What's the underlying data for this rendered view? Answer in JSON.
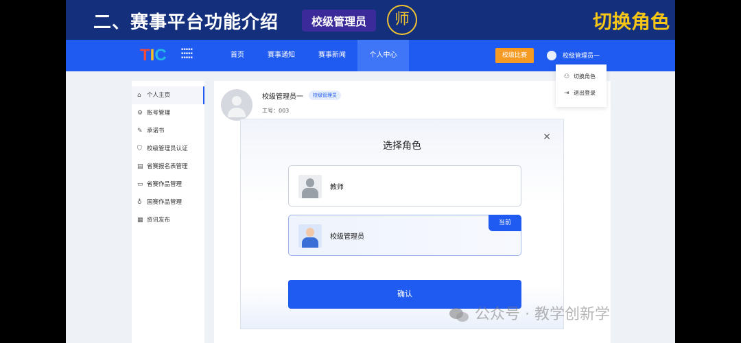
{
  "banner": {
    "title": "二、赛事平台功能介绍",
    "tag": "校级管理员",
    "logo_char": "师",
    "right_title": "切换角色"
  },
  "topnav": {
    "logo_letters": [
      "T",
      "I",
      "C"
    ],
    "items": [
      {
        "label": "首页"
      },
      {
        "label": "赛事通知"
      },
      {
        "label": "赛事新闻"
      },
      {
        "label": "个人中心"
      }
    ],
    "active_index": 3,
    "school_button": "校级比赛",
    "user_name": "校级管理员一"
  },
  "sidebar": {
    "items": [
      {
        "icon": "home-icon",
        "label": "个人主页"
      },
      {
        "icon": "gear-icon",
        "label": "账号管理"
      },
      {
        "icon": "document-edit-icon",
        "label": "承诺书"
      },
      {
        "icon": "shield-check-icon",
        "label": "校级管理员认证"
      },
      {
        "icon": "form-icon",
        "label": "省赛报名表管理"
      },
      {
        "icon": "folder-icon",
        "label": "省赛作品管理"
      },
      {
        "icon": "trophy-icon",
        "label": "国赛作品管理"
      },
      {
        "icon": "news-icon",
        "label": "资讯发布"
      }
    ],
    "active_index": 0
  },
  "profile": {
    "name": "校级管理员一",
    "badge": "校级管理员",
    "id_label": "工号：",
    "id_value": "003"
  },
  "dropdown": {
    "items": [
      {
        "icon": "switch-user-icon",
        "label": "切换角色"
      },
      {
        "icon": "logout-icon",
        "label": "退出登录"
      }
    ]
  },
  "modal": {
    "title": "选择角色",
    "roles": [
      {
        "label": "教师",
        "selected": false
      },
      {
        "label": "校级管理员",
        "selected": true
      }
    ],
    "current_badge": "当前",
    "confirm_label": "确认"
  },
  "watermark": "公众号 · 教学创新学"
}
